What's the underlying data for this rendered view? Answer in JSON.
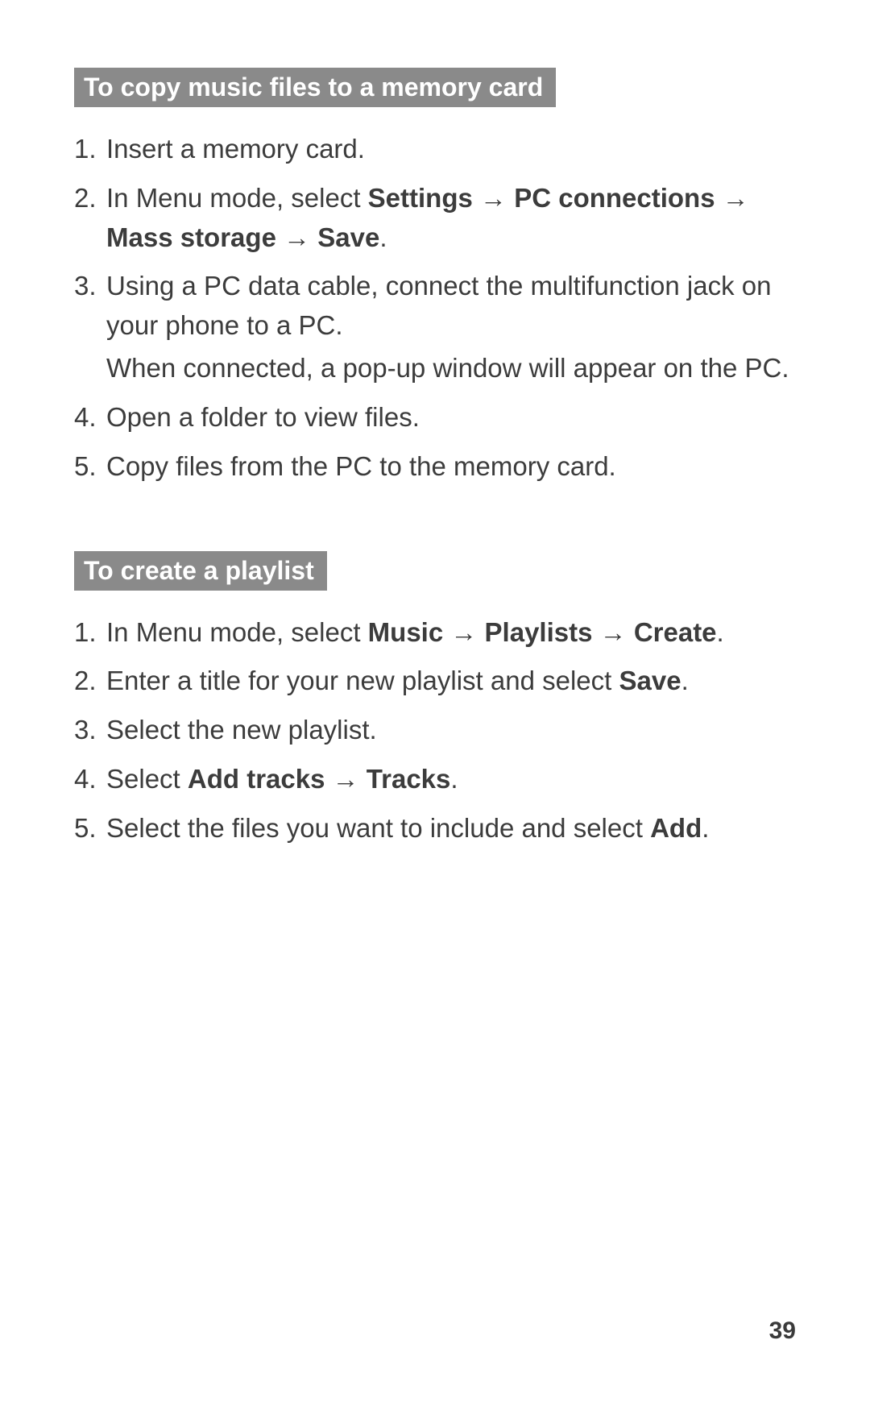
{
  "section1": {
    "heading": "To copy music files to a memory card",
    "steps": [
      {
        "parts": [
          {
            "t": "Insert a memory card."
          }
        ]
      },
      {
        "parts": [
          {
            "t": "In Menu mode, select "
          },
          {
            "t": "Settings",
            "b": true
          },
          {
            "t": " → "
          },
          {
            "t": "PC connections",
            "b": true
          },
          {
            "t": " → "
          },
          {
            "t": "Mass storage",
            "b": true
          },
          {
            "t": " → "
          },
          {
            "t": "Save",
            "b": true
          },
          {
            "t": "."
          }
        ]
      },
      {
        "paras": [
          [
            {
              "t": "Using a PC data cable, connect the multifunction jack on your phone to a PC."
            }
          ],
          [
            {
              "t": "When connected, a pop-up window will appear on the PC."
            }
          ]
        ]
      },
      {
        "parts": [
          {
            "t": "Open a folder to view files."
          }
        ]
      },
      {
        "parts": [
          {
            "t": "Copy files from the PC to the memory card."
          }
        ]
      }
    ]
  },
  "section2": {
    "heading": "To create a playlist",
    "steps": [
      {
        "parts": [
          {
            "t": "In Menu mode, select "
          },
          {
            "t": "Music",
            "b": true
          },
          {
            "t": " → "
          },
          {
            "t": "Playlists",
            "b": true
          },
          {
            "t": " → "
          },
          {
            "t": "Create",
            "b": true
          },
          {
            "t": "."
          }
        ]
      },
      {
        "parts": [
          {
            "t": "Enter a title for your new playlist and select "
          },
          {
            "t": "Save",
            "b": true
          },
          {
            "t": "."
          }
        ]
      },
      {
        "parts": [
          {
            "t": "Select the new playlist."
          }
        ]
      },
      {
        "parts": [
          {
            "t": "Select "
          },
          {
            "t": "Add tracks",
            "b": true
          },
          {
            "t": " → "
          },
          {
            "t": "Tracks",
            "b": true
          },
          {
            "t": "."
          }
        ]
      },
      {
        "parts": [
          {
            "t": "Select the files you want to include and select "
          },
          {
            "t": "Add",
            "b": true
          },
          {
            "t": "."
          }
        ]
      }
    ]
  },
  "page_number": "39"
}
